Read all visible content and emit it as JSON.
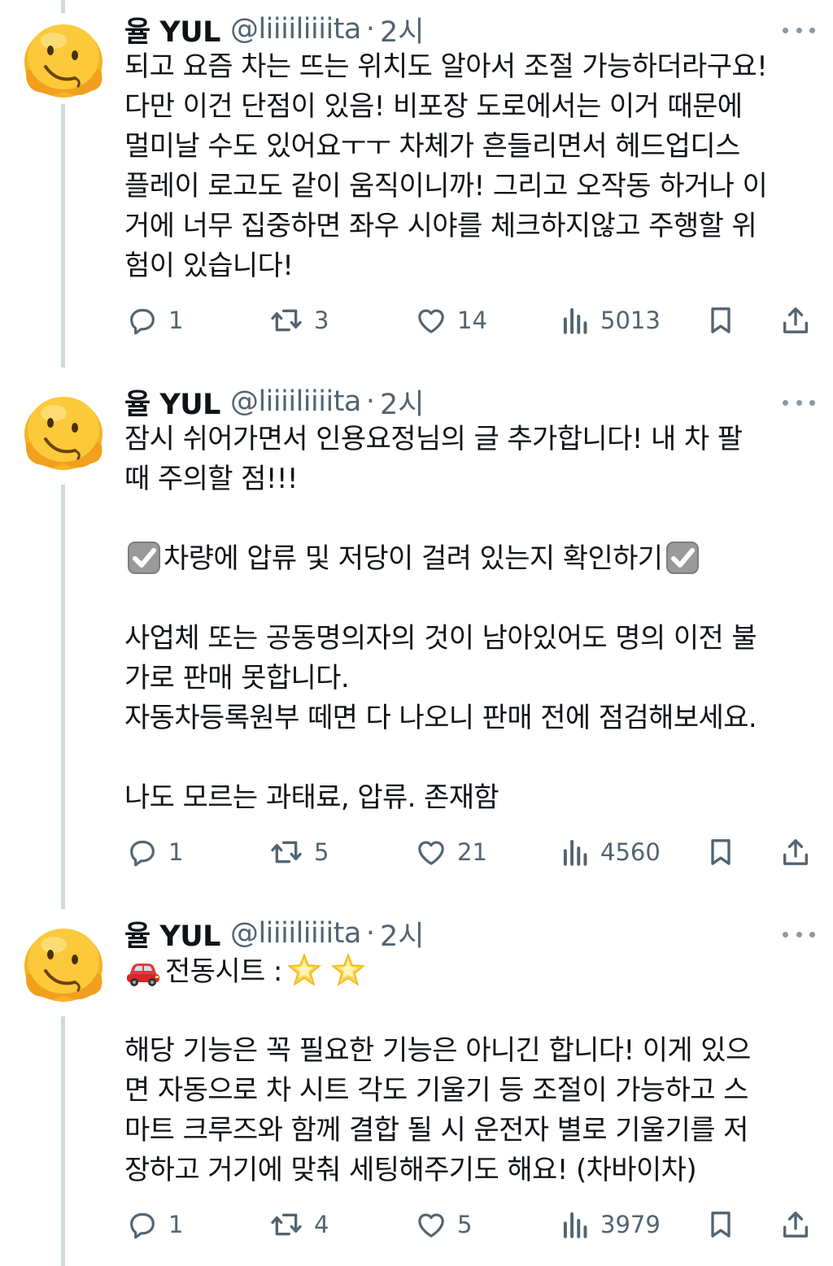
{
  "tweets": [
    {
      "author": {
        "name": "율 YUL",
        "handle": "@liiiiliiiita",
        "time": "2시"
      },
      "lines": [
        "되고 요즘 차는 뜨는 위치도 알아서 조절 가능하더라구요!",
        "다만 이건 단점이 있음! 비포장 도로에서는 이거 때문에",
        "멀미날 수도 있어요ㅜㅜ 차체가 흔들리면서 헤드업디스",
        "플레이 로고도 같이 움직이니까! 그리고 오작동 하거나 이",
        "거에 너무 집중하면 좌우 시야를 체크하지않고 주행할 위",
        "험이 있습니다!"
      ],
      "stats": {
        "replies": "1",
        "retweets": "3",
        "likes": "14",
        "views": "5013"
      }
    },
    {
      "author": {
        "name": "율 YUL",
        "handle": "@liiiiliiiita",
        "time": "2시"
      },
      "lines": [
        "잠시 쉬어가면서 인용요정님의 글 추가합니다! 내 차 팔",
        "때 주의할 점!!!",
        "",
        "차량에 압류 및 저당이 걸려 있는지 확인하기",
        "",
        "사업체 또는 공동명의자의 것이 남아있어도 명의 이전 불",
        "가로 판매 못합니다.",
        "자동차등록원부 떼면 다 나오니 판매 전에 점검해보세요.",
        "",
        "나도 모르는 과태료, 압류. 존재함"
      ],
      "stats": {
        "replies": "1",
        "retweets": "5",
        "likes": "21",
        "views": "4560"
      }
    },
    {
      "author": {
        "name": "율 YUL",
        "handle": "@liiiiliiiita",
        "time": "2시"
      },
      "lines": [
        "전동시트 :",
        "",
        "해당 기능은 꼭 필요한 기능은 아니긴 합니다! 이게 있으",
        "면 자동으로 차 시트 각도 기울기 등 조절이 가능하고 스",
        "마트 크루즈와 함께 결합 될 시 운전자 별로 기울기를 저",
        "장하고 거기에 맞춰 세팅해주기도 해요! (차바이차)"
      ],
      "stats": {
        "replies": "1",
        "retweets": "4",
        "likes": "5",
        "views": "3979"
      }
    }
  ],
  "icons": {
    "avatar": "melting-face-emoji",
    "more": "more-horizontal-icon",
    "reply": "reply-icon",
    "retweet": "retweet-icon",
    "like": "heart-icon",
    "views": "views-bar-chart-icon",
    "bookmark": "bookmark-icon",
    "share": "share-upload-icon",
    "checkbox": "check-mark-button-emoji",
    "car": "red-car-emoji",
    "star": "glowing-star-emoji"
  },
  "colors": {
    "text": "#0f1419",
    "secondary": "#536471",
    "thread_line": "#cfd9de",
    "background": "#ffffff"
  }
}
